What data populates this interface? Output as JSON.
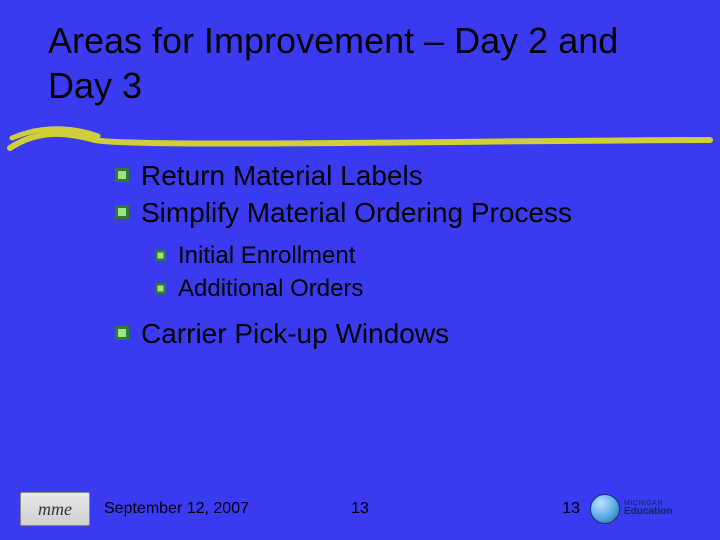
{
  "slide": {
    "title": "Areas for Improvement – Day 2 and Day 3",
    "bullets": [
      {
        "text": "Return Material Labels",
        "children": []
      },
      {
        "text": "Simplify Material Ordering Process",
        "children": [
          {
            "text": "Initial Enrollment"
          },
          {
            "text": "Additional Orders"
          }
        ]
      },
      {
        "text": "Carrier Pick-up Windows",
        "children": []
      }
    ]
  },
  "footer": {
    "left_logo": "mme",
    "date": "September 12, 2007",
    "page_center": "13",
    "page_right": "13",
    "right_logo_line1": "MICHIGAN",
    "right_logo_line2": "Education"
  },
  "colors": {
    "background": "#3a3af0",
    "underline": "#cfcf3a"
  }
}
